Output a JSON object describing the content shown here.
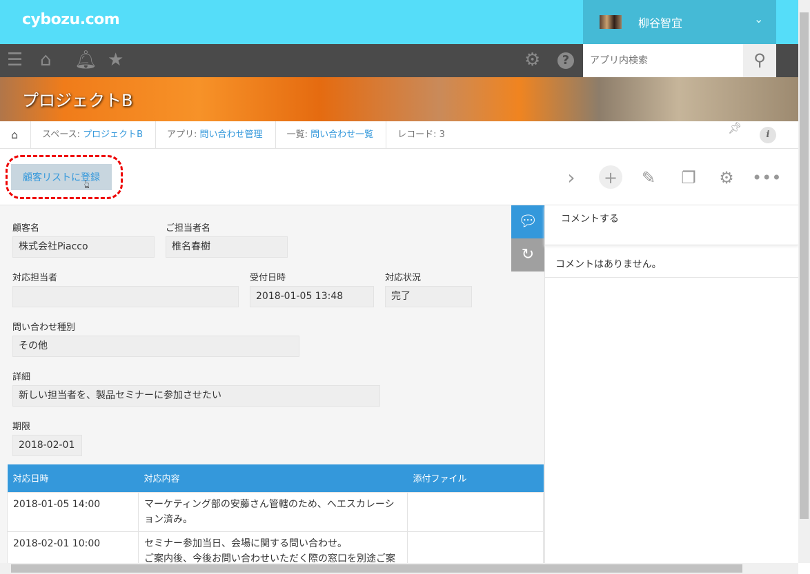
{
  "header": {
    "logo": "cybozu.com",
    "user_name": "柳谷智宜",
    "search_placeholder": "アプリ内検索"
  },
  "banner": {
    "title": "プロジェクトB"
  },
  "breadcrumb": [
    {
      "label": "スペース: ",
      "link": "プロジェクトB"
    },
    {
      "label": "アプリ: ",
      "link": "問い合わせ管理"
    },
    {
      "label": "一覧: ",
      "link": "問い合わせ一覧"
    },
    {
      "label": "レコード: 3"
    }
  ],
  "toolbar": {
    "register_button": "顧客リストに登録"
  },
  "fields": {
    "customer_label": "顧客名",
    "customer_value": "株式会社Piacco",
    "contact_label": "ご担当者名",
    "contact_value": "椎名春樹",
    "handler_label": "対応担当者",
    "handler_value": "",
    "received_label": "受付日時",
    "received_value": "2018-01-05 13:48",
    "status_label": "対応状況",
    "status_value": "完了",
    "type_label": "問い合わせ種別",
    "type_value": "その他",
    "detail_label": "詳細",
    "detail_value": "新しい担当者を、製品セミナーに参加させたい",
    "deadline_label": "期限",
    "deadline_value": "2018-02-01"
  },
  "table": {
    "headers": [
      "対応日時",
      "対応内容",
      "添付ファイル"
    ],
    "rows": [
      {
        "date": "2018-01-05 14:00",
        "content": "マーケティング部の安藤さん管轄のため、へエスカレーション済み。",
        "file": ""
      },
      {
        "date": "2018-02-01 10:00",
        "content": "セミナー参加当日、会場に関する問い合わせ。",
        "content2": "ご案内後、今後お問い合わせいただく際の窓口を別途ご案",
        "file": ""
      }
    ]
  },
  "comments": {
    "post": "コメントする",
    "empty": "コメントはありません。"
  }
}
